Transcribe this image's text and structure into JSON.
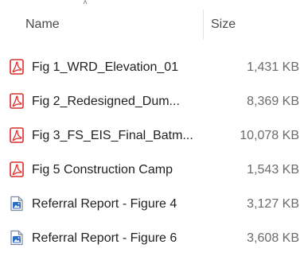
{
  "header": {
    "sort_glyph": "˄",
    "name_label": "Name",
    "size_label": "Size"
  },
  "colors": {
    "pdf_icon": "#d9302c",
    "doc_icon": "#2b6cc4",
    "name_text": "#1f1f1f",
    "size_text": "#6b6b6b"
  },
  "files": [
    {
      "icon": "pdf-icon",
      "name": "Fig 1_WRD_Elevation_01",
      "size": "1,431 KB"
    },
    {
      "icon": "pdf-icon",
      "name": "Fig 2_Redesigned_Dum...",
      "size": "8,369 KB"
    },
    {
      "icon": "pdf-icon",
      "name": "Fig 3_FS_EIS_Final_Batm...",
      "size": "10,078 KB"
    },
    {
      "icon": "pdf-icon",
      "name": "Fig 5 Construction Camp",
      "size": "1,543 KB"
    },
    {
      "icon": "image-file-icon",
      "name": "Referral Report - Figure 4",
      "size": "3,127 KB"
    },
    {
      "icon": "image-file-icon",
      "name": "Referral Report - Figure 6",
      "size": "3,608 KB"
    }
  ]
}
